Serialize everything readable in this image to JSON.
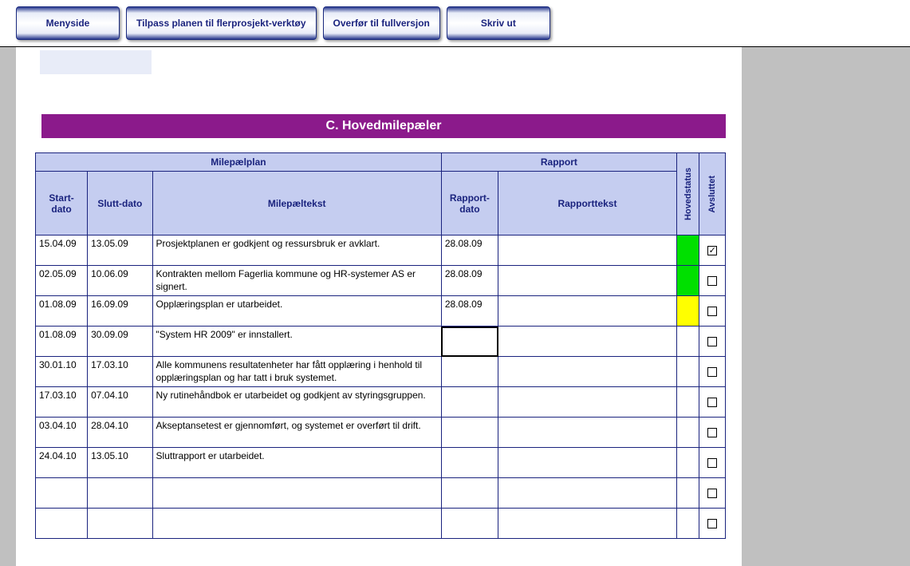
{
  "toolbar": {
    "menyside": "Menyside",
    "tilpass": "Tilpass planen til flerprosjekt-verktøy",
    "overfor": "Overfør til fullversjon",
    "skrivut": "Skriv ut"
  },
  "banner": "C. Hovedmilepæler",
  "headers": {
    "grp_plan": "Milepælplan",
    "grp_rapport": "Rapport",
    "start": "Start-dato",
    "slutt": "Slutt-dato",
    "tekst": "Milepæltekst",
    "rdato": "Rapport-dato",
    "rtekst": "Rapporttekst",
    "hovedstatus": "Hovedstatus",
    "avsluttet": "Avsluttet"
  },
  "rows": [
    {
      "start": "15.04.09",
      "slutt": "13.05.09",
      "tekst": "Prosjektplanen er godkjent og ressursbruk er avklart.",
      "rdato": "28.08.09",
      "rtekst": "",
      "status": "green",
      "avsluttet": true
    },
    {
      "start": "02.05.09",
      "slutt": "10.06.09",
      "tekst": "Kontrakten mellom Fagerlia kommune og HR-systemer AS er signert.",
      "rdato": "28.08.09",
      "rtekst": "",
      "status": "green",
      "avsluttet": false
    },
    {
      "start": "01.08.09",
      "slutt": "16.09.09",
      "tekst": "Opplæringsplan er utarbeidet.",
      "rdato": "28.08.09",
      "rtekst": "",
      "status": "yellow",
      "avsluttet": false
    },
    {
      "start": "01.08.09",
      "slutt": "30.09.09",
      "tekst": "\"System HR 2009\" er innstallert.",
      "rdato": "",
      "rtekst": "",
      "status": "",
      "avsluttet": false,
      "selected": true
    },
    {
      "start": "30.01.10",
      "slutt": "17.03.10",
      "tekst": "Alle kommunens resultatenheter har fått opplæring i henhold til opplæringsplan og har tatt i bruk systemet.",
      "rdato": "",
      "rtekst": "",
      "status": "",
      "avsluttet": false
    },
    {
      "start": "17.03.10",
      "slutt": "07.04.10",
      "tekst": "Ny rutinehåndbok er utarbeidet og godkjent av styringsgruppen.",
      "rdato": "",
      "rtekst": "",
      "status": "",
      "avsluttet": false
    },
    {
      "start": "03.04.10",
      "slutt": "28.04.10",
      "tekst": "Akseptansetest er gjennomført, og systemet er overført til drift.",
      "rdato": "",
      "rtekst": "",
      "status": "",
      "avsluttet": false
    },
    {
      "start": "24.04.10",
      "slutt": "13.05.10",
      "tekst": "Sluttrapport er utarbeidet.",
      "rdato": "",
      "rtekst": "",
      "status": "",
      "avsluttet": false
    },
    {
      "start": "",
      "slutt": "",
      "tekst": "",
      "rdato": "",
      "rtekst": "",
      "status": "",
      "avsluttet": false
    },
    {
      "start": "",
      "slutt": "",
      "tekst": "",
      "rdato": "",
      "rtekst": "",
      "status": "",
      "avsluttet": false
    }
  ]
}
